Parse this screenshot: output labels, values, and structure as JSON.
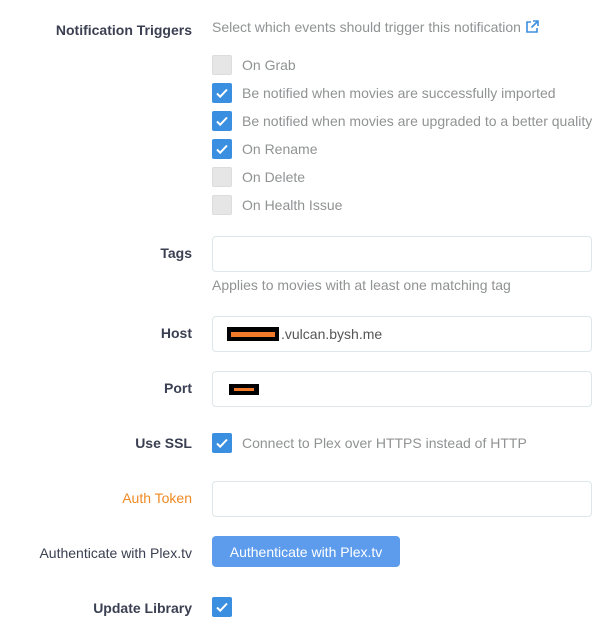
{
  "notification_triggers": {
    "label": "Notification Triggers",
    "help": "Select which events should trigger this notification",
    "help_icon": "external-link-icon",
    "options": [
      {
        "label": "On Grab",
        "checked": false
      },
      {
        "label": "Be notified when movies are successfully imported",
        "checked": true
      },
      {
        "label": "Be notified when movies are upgraded to a better quality",
        "checked": true
      },
      {
        "label": "On Rename",
        "checked": true
      },
      {
        "label": "On Delete",
        "checked": false
      },
      {
        "label": "On Health Issue",
        "checked": false
      }
    ]
  },
  "tags": {
    "label": "Tags",
    "value": "",
    "help": "Applies to movies with at least one matching tag"
  },
  "host": {
    "label": "Host",
    "value_visible": ".vulcan.bysh.me"
  },
  "port": {
    "label": "Port"
  },
  "use_ssl": {
    "label": "Use SSL",
    "checked": true,
    "help": "Connect to Plex over HTTPS instead of HTTP"
  },
  "auth_token": {
    "label": "Auth Token",
    "value": ""
  },
  "authenticate": {
    "label": "Authenticate with Plex.tv",
    "button_label": "Authenticate with Plex.tv"
  },
  "update_library": {
    "label": "Update Library",
    "checked": true
  },
  "colors": {
    "accent": "#5d9cec",
    "checkbox_checked": "#3b8fe0",
    "warning_label": "#f08a24",
    "redaction_bar": "#f07a2a"
  }
}
